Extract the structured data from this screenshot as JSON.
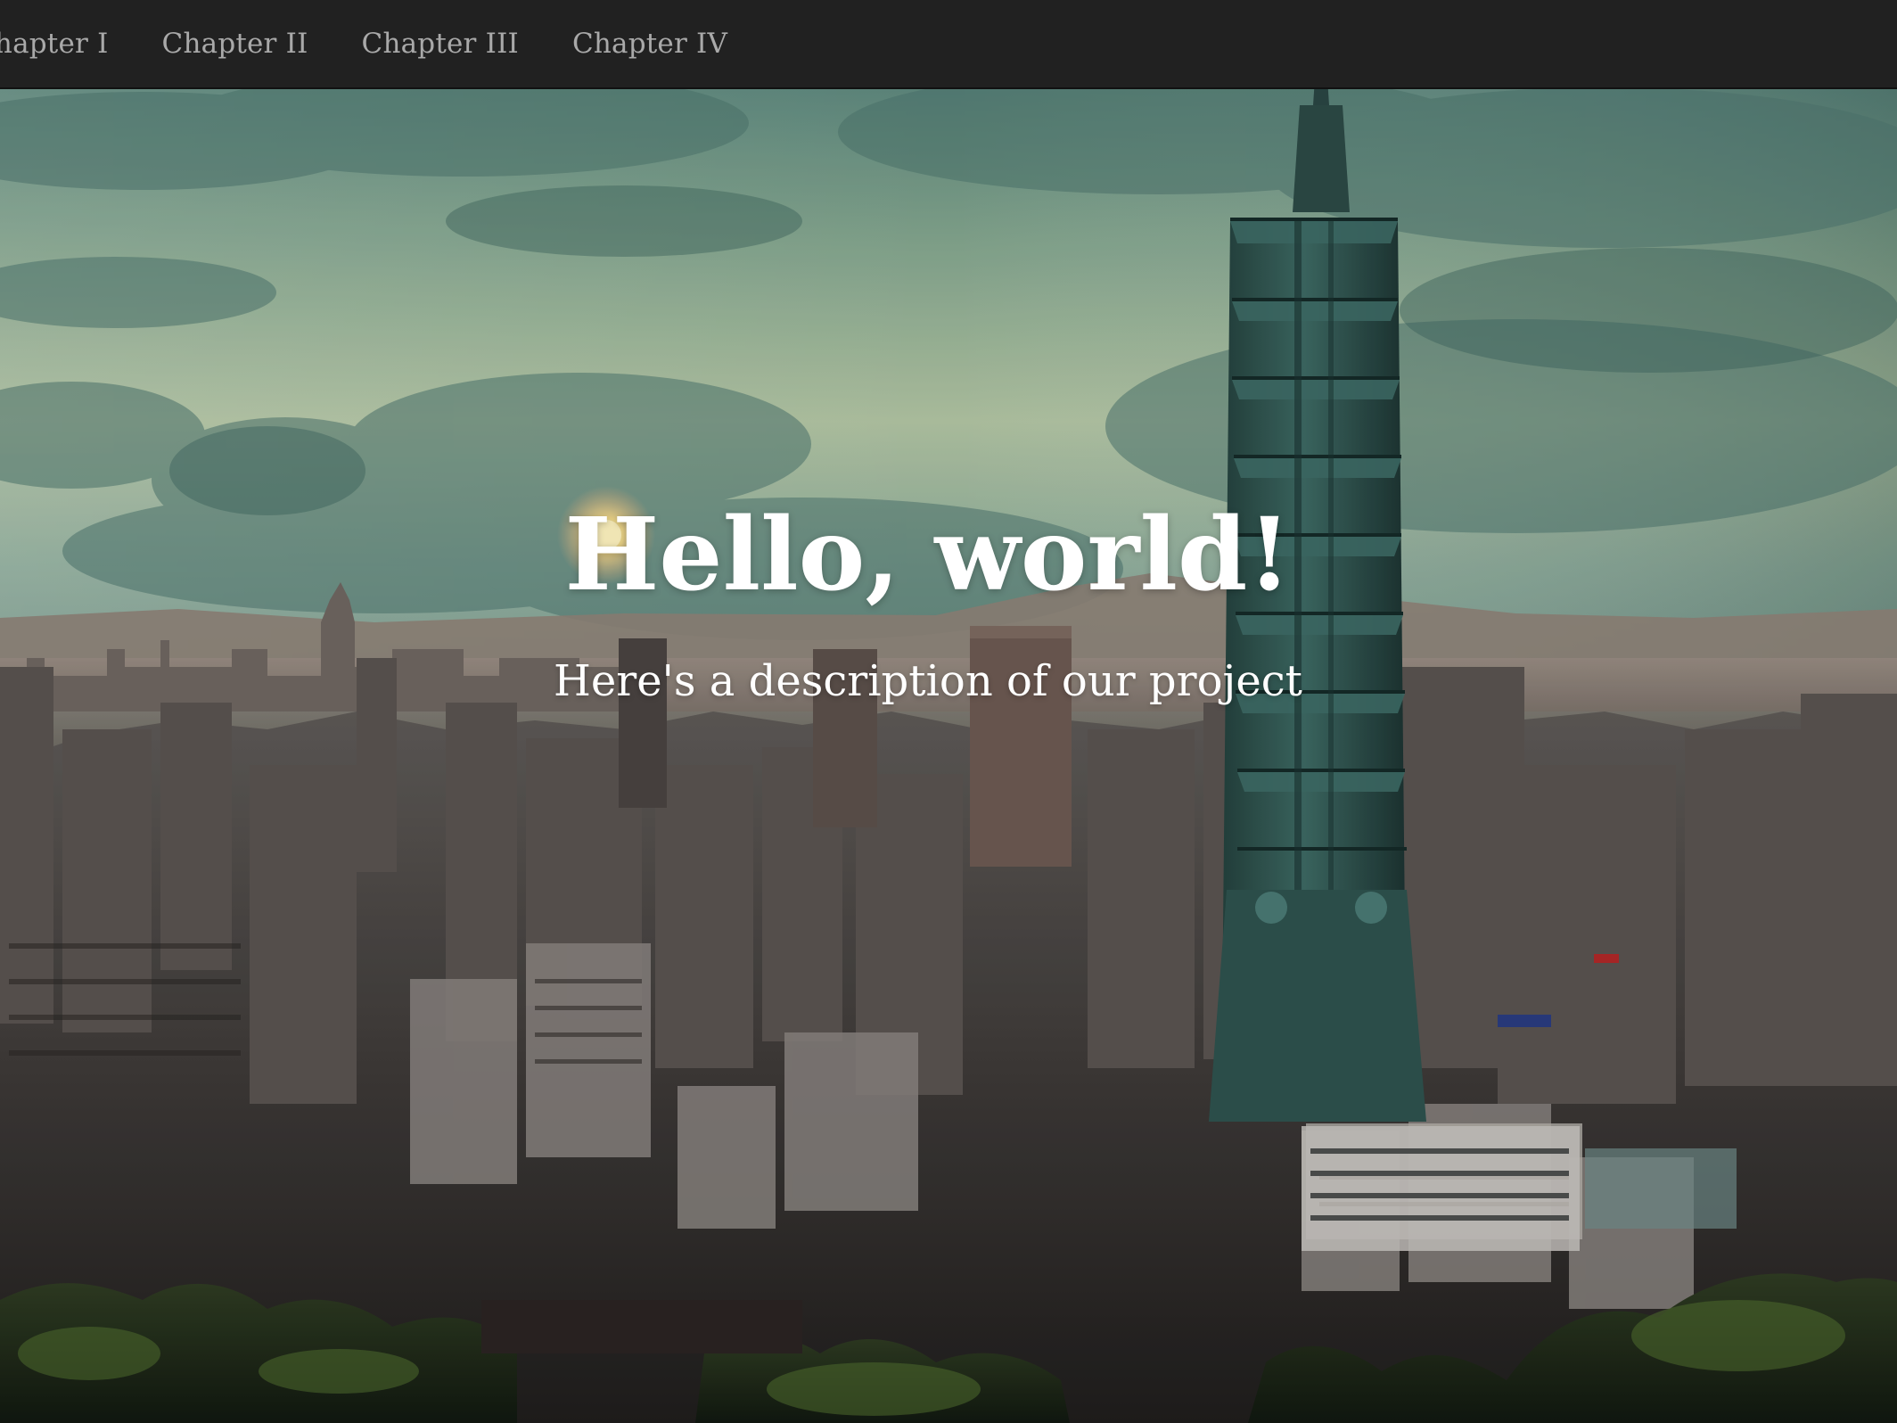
{
  "nav": {
    "items": [
      {
        "label": "Chapter I"
      },
      {
        "label": "Chapter II"
      },
      {
        "label": "Chapter III"
      },
      {
        "label": "Chapter IV"
      }
    ]
  },
  "hero": {
    "title": "Hello, world!",
    "subtitle": "Here's a description of our project"
  },
  "colors": {
    "navbar_bg": "#212121",
    "nav_link": "#a9a9a9",
    "hero_text": "#ffffff"
  }
}
